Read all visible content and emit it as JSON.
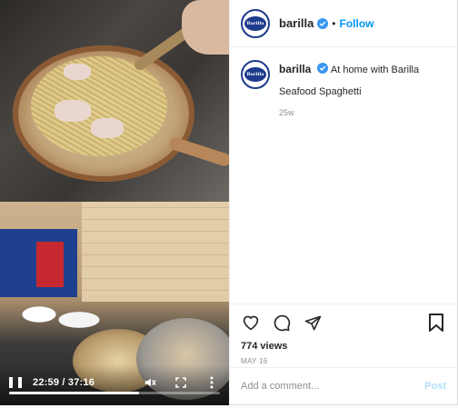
{
  "video": {
    "time": "22:59 / 37:16",
    "progress": 0.617,
    "icons": {
      "play_pause": "pause-icon",
      "mute": "muted-speaker-icon",
      "fullscreen": "fullscreen-icon",
      "more": "more-vertical-icon"
    }
  },
  "header": {
    "username": "barilla",
    "separator": "•",
    "follow_label": "Follow"
  },
  "caption": {
    "username": "barilla",
    "text": "At home with Barilla",
    "title": "Seafood Spaghetti",
    "age": "25w"
  },
  "actions": {
    "views": "774 views",
    "date": "MAY 16",
    "icons": [
      "heart-icon",
      "comment-icon",
      "share-icon",
      "bookmark-icon"
    ]
  },
  "comment": {
    "placeholder": "Add a comment...",
    "post_label": "Post"
  },
  "avatar_text": "Barilla",
  "colors": {
    "accent": "#0095f6",
    "post_disabled": "#b2dffc",
    "brand_blue": "#1d3b8c",
    "verified": "#3897f0"
  }
}
